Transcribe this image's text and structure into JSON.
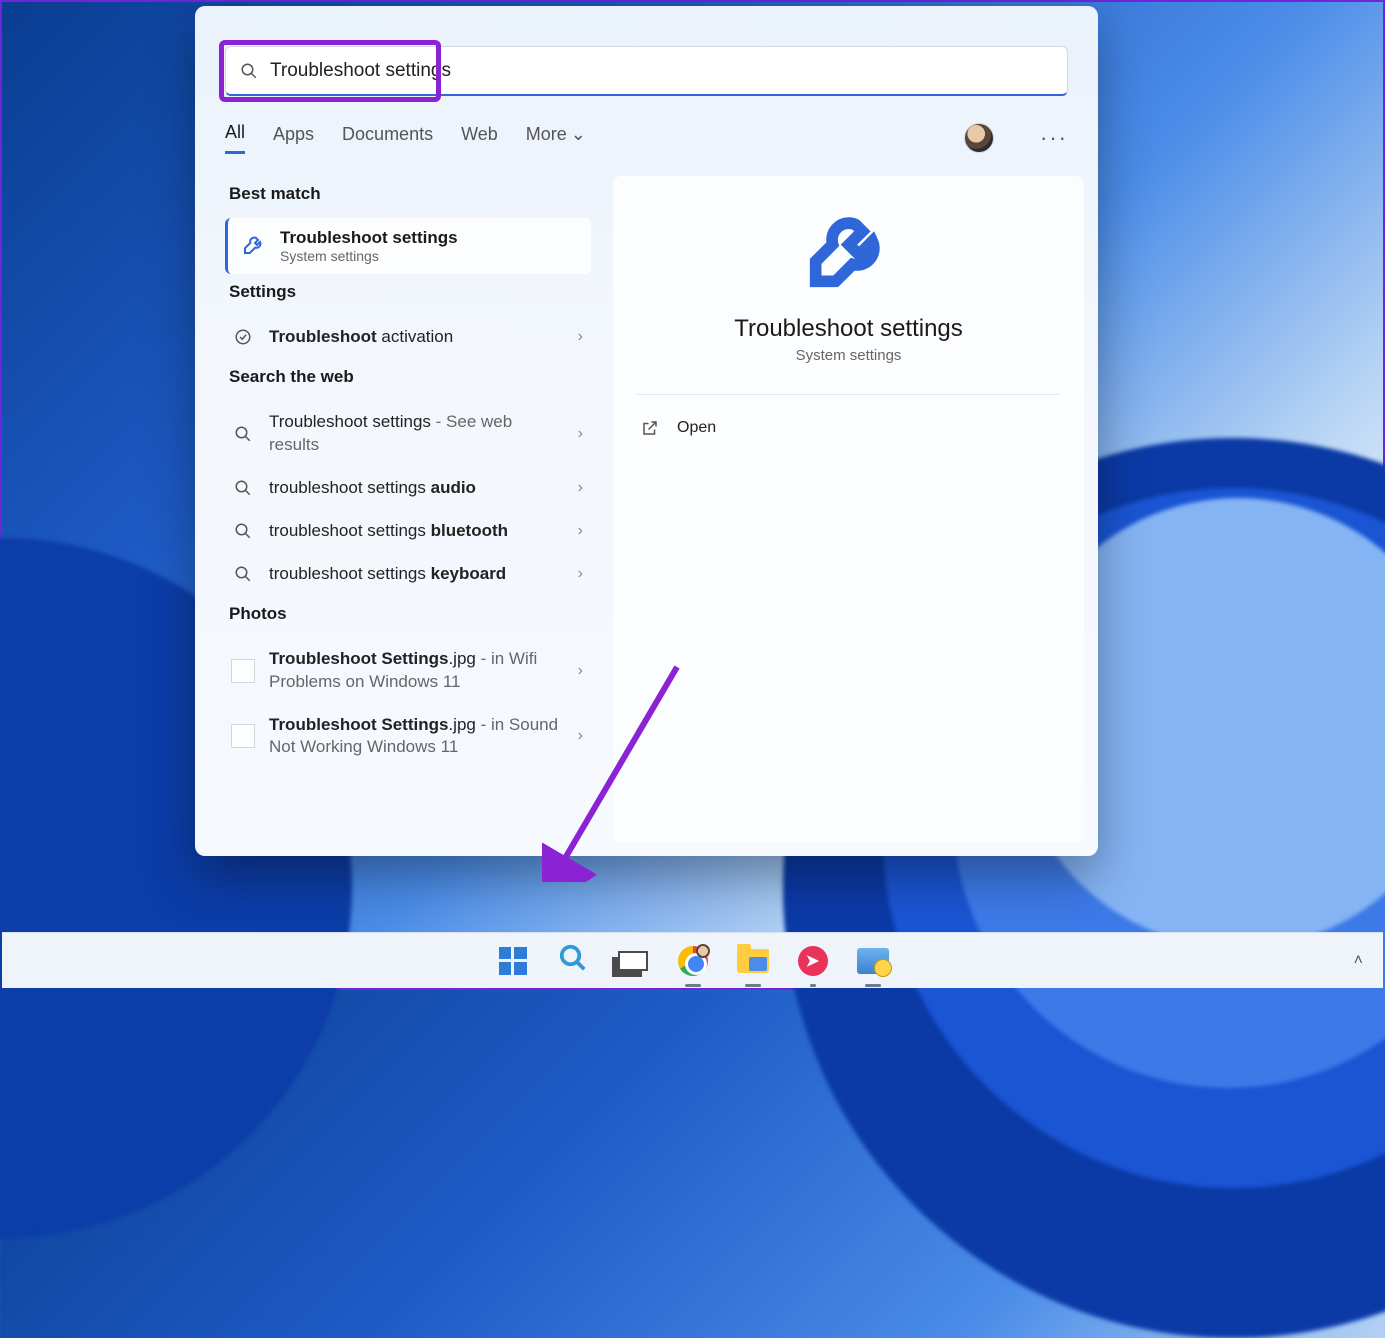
{
  "search": {
    "value": "Troubleshoot settings"
  },
  "tabs": {
    "all": "All",
    "apps": "Apps",
    "documents": "Documents",
    "web": "Web",
    "more": "More"
  },
  "sections": {
    "best_match": "Best match",
    "settings": "Settings",
    "search_web": "Search the web",
    "photos": "Photos"
  },
  "best_match": {
    "title": "Troubleshoot settings",
    "subtitle": "System settings"
  },
  "settings_results": [
    {
      "prefix_bold": "Troubleshoot",
      "rest": " activation"
    }
  ],
  "web_results": [
    {
      "prefix": "Troubleshoot settings",
      "suffix": " - See web results"
    },
    {
      "prefix": "troubleshoot settings ",
      "bold": "audio"
    },
    {
      "prefix": "troubleshoot settings ",
      "bold": "bluetooth"
    },
    {
      "prefix": "troubleshoot settings ",
      "bold": "keyboard"
    }
  ],
  "photo_results": [
    {
      "name_bold": "Troubleshoot Settings",
      "ext": ".jpg",
      "suffix": " - in Wifi Problems on Windows 11"
    },
    {
      "name_bold": "Troubleshoot Settings",
      "ext": ".jpg",
      "suffix": " - in Sound Not Working Windows 11"
    }
  ],
  "preview": {
    "title": "Troubleshoot settings",
    "subtitle": "System settings",
    "open": "Open"
  }
}
